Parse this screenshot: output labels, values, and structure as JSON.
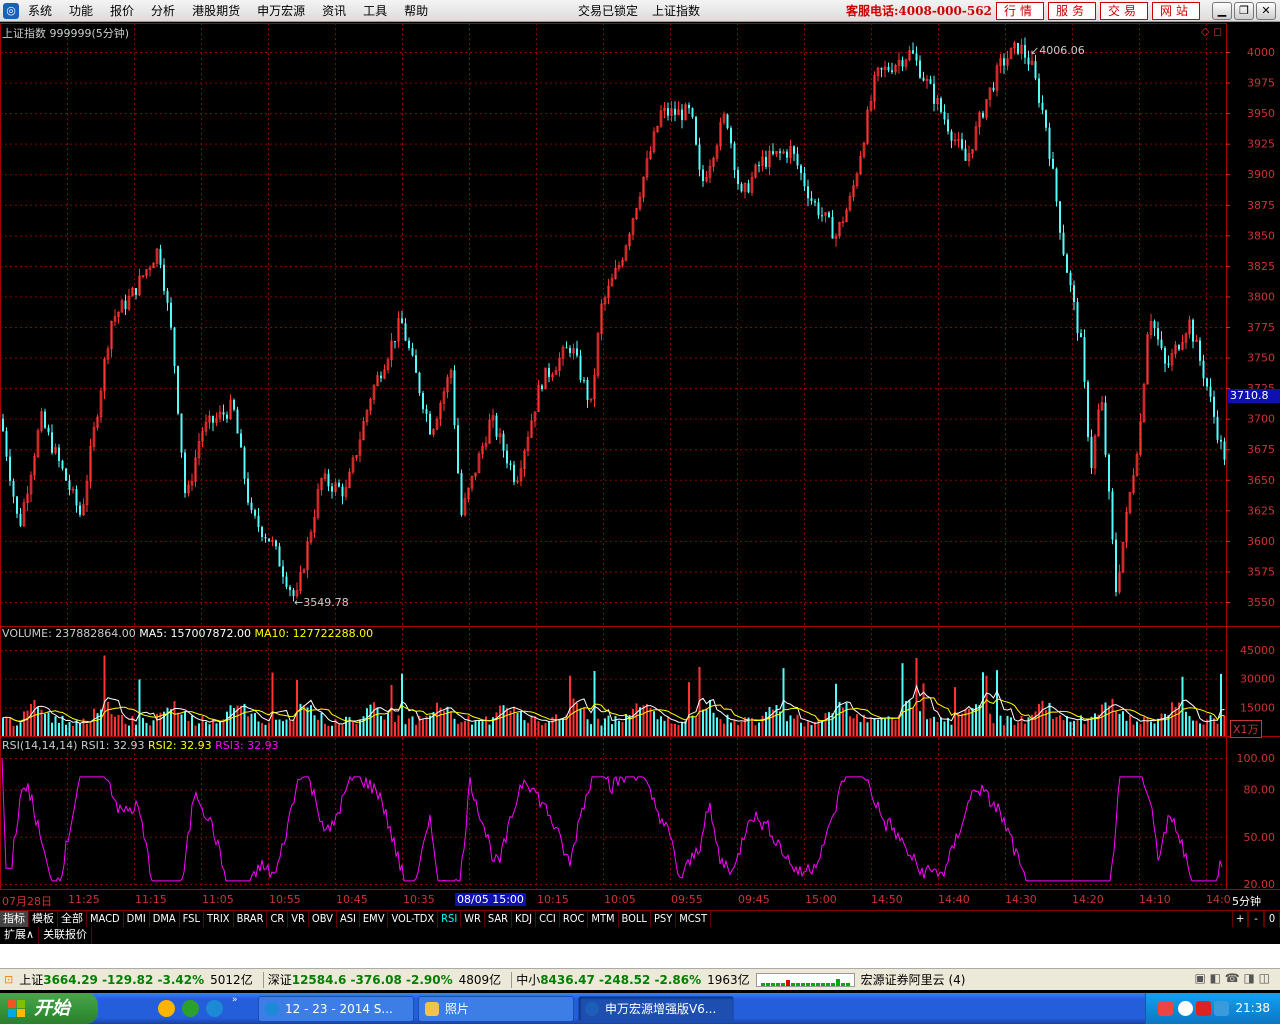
{
  "menubar": {
    "items": [
      "系统",
      "功能",
      "报价",
      "分析",
      "港股期货",
      "申万宏源",
      "资讯",
      "工具",
      "帮助"
    ],
    "center": [
      "交易已锁定",
      "上证指数"
    ],
    "phone": "客服电话:4008-000-562",
    "buttons": [
      "行情",
      "服务",
      "交易",
      "网站"
    ]
  },
  "main": {
    "title": "上证指数 999999(5分钟)",
    "high_label": "4006.06",
    "low_label": "3549.78",
    "current_price": "3710.8",
    "y_ticks": [
      "4000",
      "3975",
      "3950",
      "3925",
      "3900",
      "3875",
      "3850",
      "3825",
      "3800",
      "3775",
      "3750",
      "3725",
      "3700",
      "3675",
      "3650",
      "3625",
      "3600",
      "3575",
      "3550"
    ]
  },
  "volume": {
    "label": "VOLUME: 237882864.00",
    "ma5": "MA5: 157007872.00",
    "ma10": "MA10: 127722288.00",
    "y_ticks": [
      "45000",
      "30000",
      "15000"
    ],
    "unit": "X1万"
  },
  "rsi": {
    "label": "RSI(14,14,14)",
    "rsi1": "RSI1: 32.93",
    "rsi2": "RSI2: 32.93",
    "rsi3": "RSI3: 32.93",
    "y_ticks": [
      "100.00",
      "80.00",
      "50.00",
      "20.00"
    ]
  },
  "xaxis": {
    "labels": [
      "07月28日",
      "11:25",
      "11:15",
      "11:05",
      "10:55",
      "10:45",
      "10:35",
      "08/05 15:00",
      "10:15",
      "10:05",
      "09:55",
      "09:45",
      "15:00",
      "14:50",
      "14:40",
      "14:30",
      "14:20",
      "14:10",
      "14:0"
    ],
    "period": "5分钟"
  },
  "tabs": [
    "指标",
    "模板",
    "全部",
    "MACD",
    "DMI",
    "DMA",
    "FSL",
    "TRIX",
    "BRAR",
    "CR",
    "VR",
    "OBV",
    "ASI",
    "EMV",
    "VOL-TDX",
    "RSI",
    "WR",
    "SAR",
    "KDJ",
    "CCI",
    "ROC",
    "MTM",
    "BOLL",
    "PSY",
    "MCST"
  ],
  "tab_controls": [
    "+",
    "-",
    "0"
  ],
  "tabs2": [
    "扩展∧",
    "关联报价"
  ],
  "status": {
    "sh_name": "上证",
    "sh_value": "3664.29 -129.82 -3.42%",
    "sh_amount": "5012亿",
    "sz_name": "深证",
    "sz_value": "12584.6 -376.08 -2.90%",
    "sz_amount": "4809亿",
    "zx_name": "中小",
    "zx_value": "8436.47 -248.52 -2.86%",
    "zx_amount": "1963亿",
    "broker": "宏源证券阿里云 (4)"
  },
  "taskbar": {
    "start": "开始",
    "tasks": [
      "12 - 23 - 2014 S...",
      "照片",
      "申万宏源增强版V6..."
    ],
    "clock": "21:38"
  },
  "colors": {
    "up": "#ff3232",
    "down": "#54fcfc",
    "rsi": "#ff00ff",
    "grid": "#8b0000",
    "ma5": "#ffffff",
    "ma10": "#ffff00"
  }
}
